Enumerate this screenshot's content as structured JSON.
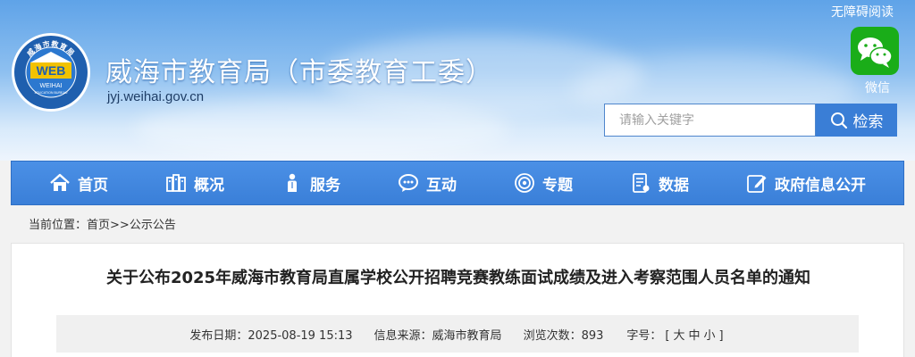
{
  "header": {
    "site_title": "威海市教育局（市委教育工委）",
    "site_domain": "jyj.weihai.gov.cn",
    "accessible_read": "无障碍阅读",
    "wechat_label": "微信",
    "logo": {
      "ring_text": "威海市教育局",
      "main_text": "WEB",
      "sub_text": "WEIHAI",
      "small_text": "EDUCATION BUREAU"
    }
  },
  "search": {
    "placeholder": "请输入关键字",
    "button_label": "检索"
  },
  "nav": {
    "items": [
      {
        "label": "首页",
        "icon": "home-icon"
      },
      {
        "label": "概况",
        "icon": "building-icon"
      },
      {
        "label": "服务",
        "icon": "person-icon"
      },
      {
        "label": "互动",
        "icon": "chat-icon"
      },
      {
        "label": "专题",
        "icon": "target-icon"
      },
      {
        "label": "数据",
        "icon": "data-icon"
      },
      {
        "label": "政府信息公开",
        "icon": "edit-icon"
      }
    ]
  },
  "breadcrumb": {
    "prefix": "当前位置：",
    "home": "首页",
    "sep": ">>",
    "current": "公示公告"
  },
  "article": {
    "title": "关于公布2025年威海市教育局直属学校公开招聘竞赛教练面试成绩及进入考察范围人员名单的通知",
    "publish_label": "发布日期：",
    "publish_date": "2025-08-19 15:13",
    "source_label": "信息来源：",
    "source": "威海市教育局",
    "views_label": "浏览次数：",
    "views": "893",
    "font_label": "字号：",
    "font_open": "[",
    "font_large": "大",
    "font_medium": "中",
    "font_small": "小",
    "font_close": "]"
  },
  "colors": {
    "nav_bg": "#3a7fd8",
    "search_btn": "#3a7ed6",
    "wechat_green": "#1aad19"
  }
}
